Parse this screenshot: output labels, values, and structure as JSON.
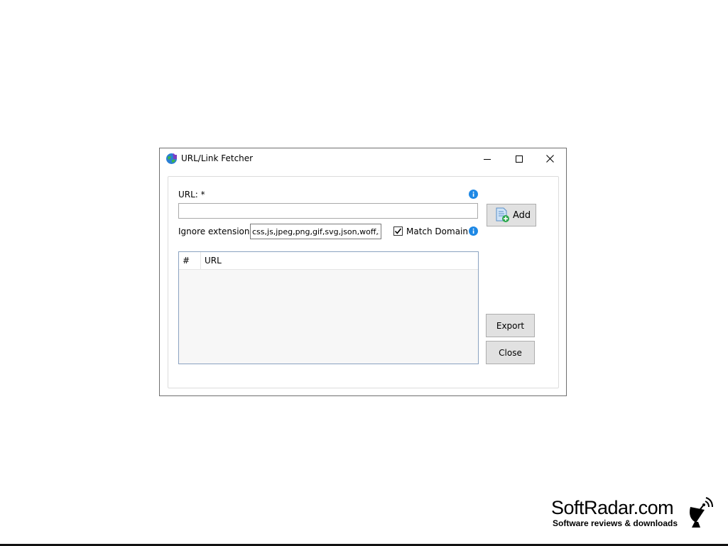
{
  "window": {
    "title": "URL/Link Fetcher",
    "icon": "globe-app-icon"
  },
  "form": {
    "url_label": "URL: *",
    "url_value": "",
    "ignore_label": "Ignore extensions:",
    "ignore_value": "css,js,jpeg,png,gif,svg,json,woff,xml",
    "match_domain_label": "Match Domain",
    "match_domain_checked": true
  },
  "buttons": {
    "add_label": "Add",
    "export_label": "Export",
    "close_label": "Close"
  },
  "list": {
    "columns": [
      "#",
      "URL"
    ],
    "rows": []
  },
  "watermark": {
    "title": "SoftRadar.com",
    "subtitle": "Software reviews & downloads"
  },
  "colors": {
    "info_blue": "#1e88e5",
    "button_bg": "#e1e1e1",
    "list_border": "#8aa2c0"
  }
}
